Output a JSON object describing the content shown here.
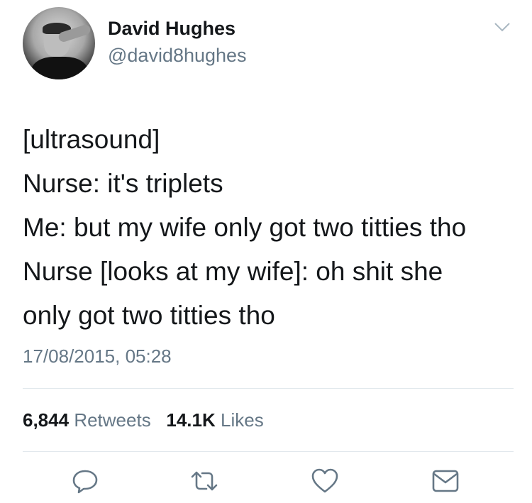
{
  "user": {
    "name": "David Hughes",
    "handle": "@david8hughes"
  },
  "tweet": {
    "lines": [
      "[ultrasound]",
      "Nurse: it's triplets",
      "Me: but my wife only got two titties tho",
      "Nurse [looks at my wife]: oh shit she",
      "only got two titties tho"
    ],
    "timestamp": "17/08/2015, 05:28"
  },
  "stats": {
    "retweets_count": "6,844",
    "retweets_label": "Retweets",
    "likes_count": "14.1K",
    "likes_label": "Likes"
  },
  "icons": {
    "menu": "chevron-down-icon",
    "reply": "reply-icon",
    "retweet": "retweet-icon",
    "like": "heart-icon",
    "message": "envelope-icon"
  },
  "colors": {
    "text": "#14171a",
    "secondary": "#657786",
    "divider": "#e1e8ed"
  }
}
